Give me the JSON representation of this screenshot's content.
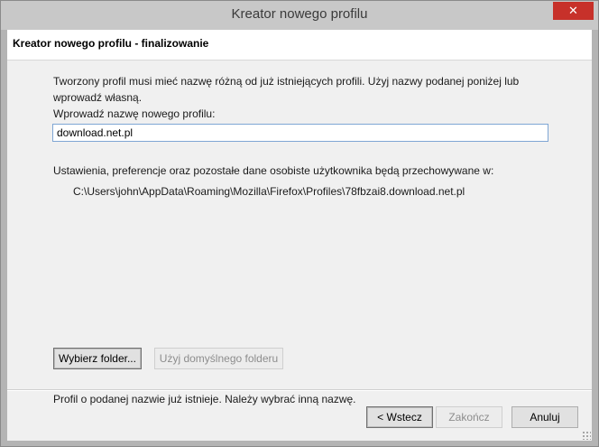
{
  "window": {
    "title": "Kreator nowego profilu",
    "close_glyph": "✕"
  },
  "header": {
    "title": "Kreator nowego profilu - finalizowanie"
  },
  "content": {
    "description": "Tworzony profil musi mieć nazwę różną od już istniejących profili. Użyj nazwy podanej poniżej lub wprowadź własną.",
    "name_label": "Wprowadź nazwę nowego profilu:",
    "name_value": "download.net.pl",
    "settings_label": "Ustawienia, preferencje oraz pozostałe dane osobiste użytkownika będą przechowywane w:",
    "path": "C:\\Users\\john\\AppData\\Roaming\\Mozilla\\Firefox\\Profiles\\78fbzai8.download.net.pl",
    "browse_label": "Wybierz folder...",
    "default_folder_label": "Użyj domyślnego folderu",
    "status": "Profil o podanej nazwie już istnieje. Należy wybrać inną nazwę."
  },
  "footer": {
    "back_label": "< Wstecz",
    "finish_label": "Zakończ",
    "cancel_label": "Anuluj"
  },
  "colors": {
    "close_button": "#c7312a",
    "input_border": "#7fa6d4",
    "dialog_background": "#f0f0f0"
  }
}
